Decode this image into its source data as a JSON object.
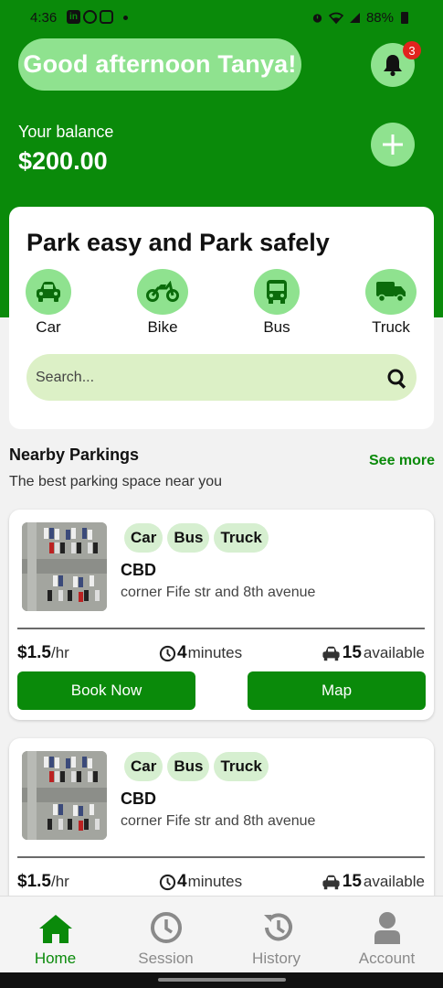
{
  "status_bar": {
    "time": "4:36",
    "battery": "88%",
    "app_icons": [
      "linkedin-icon",
      "whatsapp-icon",
      "instagram-icon"
    ]
  },
  "header": {
    "greeting": "Good afternoon Tanya!",
    "notification_count": "3",
    "balance_label": "Your balance",
    "balance_value": "$200.00"
  },
  "park_card": {
    "title": "Park easy and Park safely",
    "vehicles": [
      {
        "label": "Car",
        "icon": "car-icon"
      },
      {
        "label": "Bike",
        "icon": "motorcycle-icon"
      },
      {
        "label": "Bus",
        "icon": "bus-icon"
      },
      {
        "label": "Truck",
        "icon": "truck-icon"
      }
    ],
    "search_placeholder": "Search..."
  },
  "nearby": {
    "title": "Nearby Parkings",
    "see_more": "See more",
    "subtitle": "The best parking space near you"
  },
  "parkings": [
    {
      "tags": [
        "Car",
        "Bus",
        "Truck"
      ],
      "name": "CBD",
      "address": "corner Fife str and 8th avenue",
      "price": "$1.5",
      "price_unit": "/hr",
      "time": "4",
      "time_unit": "minutes",
      "available": "15",
      "available_unit": "available",
      "book_label": "Book Now",
      "map_label": "Map"
    },
    {
      "tags": [
        "Car",
        "Bus",
        "Truck"
      ],
      "name": "CBD",
      "address": "corner Fife str and 8th avenue",
      "price": "$1.5",
      "price_unit": "/hr",
      "time": "4",
      "time_unit": "minutes",
      "available": "15",
      "available_unit": "available"
    }
  ],
  "bottom_nav": [
    {
      "label": "Home",
      "icon": "home-icon",
      "active": true
    },
    {
      "label": "Session",
      "icon": "clock-icon",
      "active": false
    },
    {
      "label": "History",
      "icon": "history-icon",
      "active": false
    },
    {
      "label": "Account",
      "icon": "user-icon",
      "active": false
    }
  ],
  "colors": {
    "primary": "#0a8a0a",
    "light_green": "#8fe28f",
    "search_bg": "#dcf0c6",
    "tag_bg": "#d6efd0",
    "badge": "#e2241e"
  }
}
